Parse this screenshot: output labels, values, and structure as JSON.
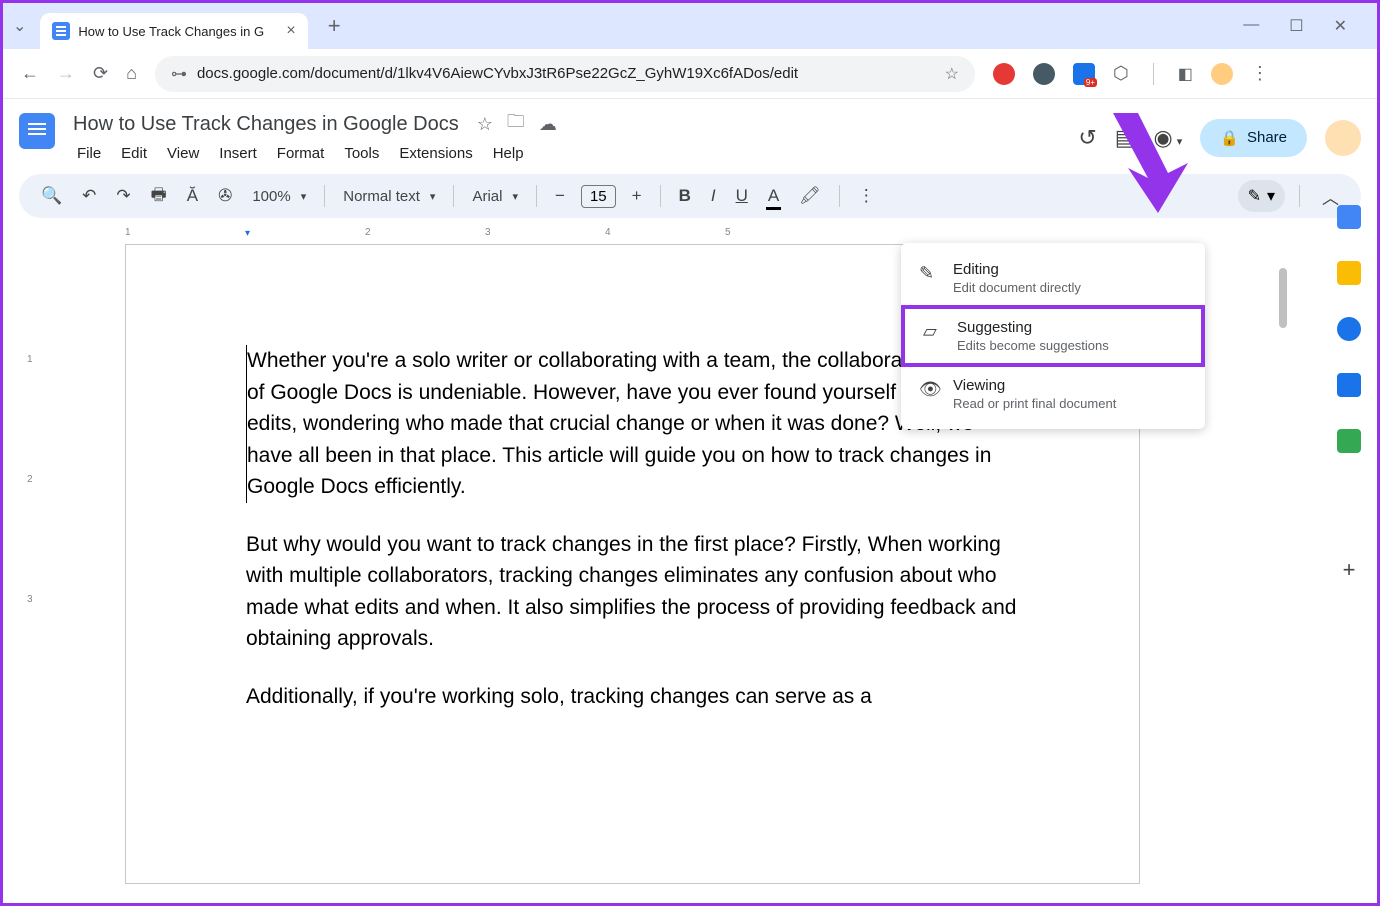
{
  "browser": {
    "tab_title": "How to Use Track Changes in G",
    "url": "docs.google.com/document/d/1lkv4V6AiewCYvbxJ3tR6Pse22GcZ_GyhW19Xc6fADos/edit"
  },
  "docs": {
    "title": "How to Use Track Changes in Google Docs",
    "menu": [
      "File",
      "Edit",
      "View",
      "Insert",
      "Format",
      "Tools",
      "Extensions",
      "Help"
    ],
    "share_label": "Share"
  },
  "toolbar": {
    "zoom": "100%",
    "style": "Normal text",
    "font": "Arial",
    "fontsize": "15"
  },
  "mode_menu": [
    {
      "title": "Editing",
      "sub": "Edit document directly",
      "icon": "✎"
    },
    {
      "title": "Suggesting",
      "sub": "Edits become suggestions",
      "icon": "▱"
    },
    {
      "title": "Viewing",
      "sub": "Read or print final document",
      "icon": "👁"
    }
  ],
  "document": {
    "p1": "Whether you're a solo writer or collaborating with a team, the collaborative power of Google Docs is undeniable. However, have you ever found yourself lost in the edits, wondering who made that crucial change or when it was done? Well, we have all been in that place. This article will guide you on how to track changes in Google Docs efficiently.",
    "p2": "But why would you want to track changes in the first place? Firstly, When working with multiple collaborators, tracking changes eliminates any confusion about who made what edits and when. It also simplifies the process of providing feedback and obtaining approvals.",
    "p3": "Additionally, if you're working solo, tracking changes can serve as a"
  },
  "ruler_numbers": [
    "1",
    "2",
    "3",
    "4",
    "5"
  ],
  "vruler_numbers": [
    "1",
    "2",
    "3"
  ]
}
